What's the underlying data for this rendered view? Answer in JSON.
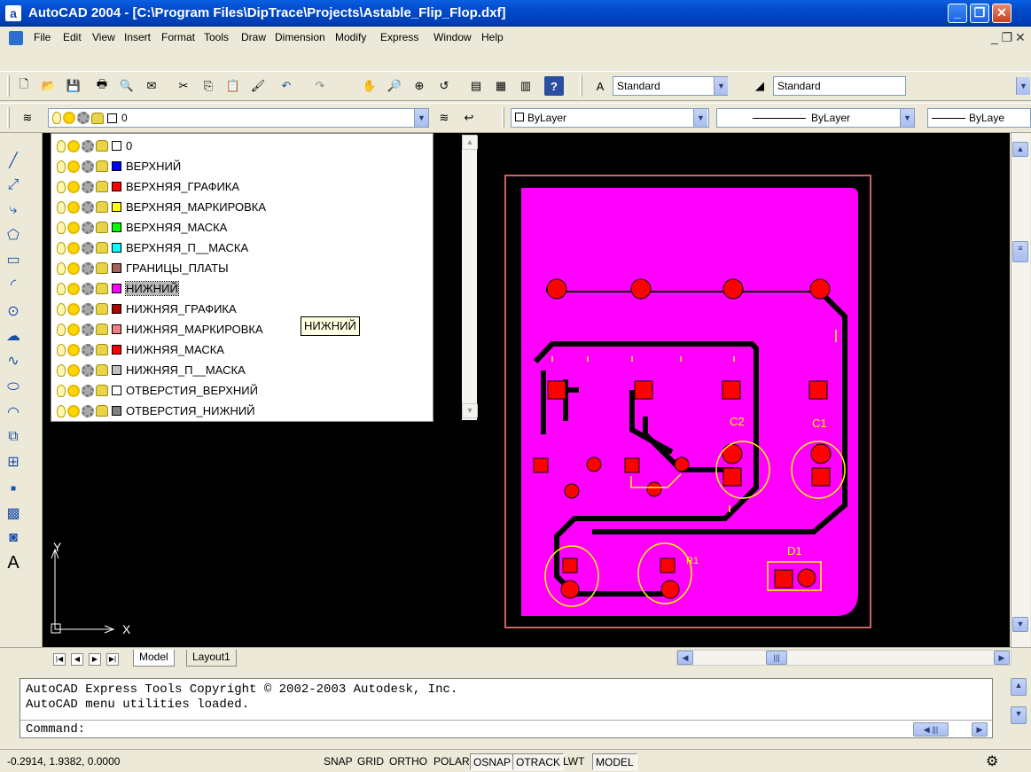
{
  "window": {
    "title": "AutoCAD 2004 - [C:\\Program Files\\DipTrace\\Projects\\Astable_Flip_Flop.dxf]",
    "app_letter": "a"
  },
  "menu": {
    "items": [
      "File",
      "Edit",
      "View",
      "Insert",
      "Format",
      "Tools",
      "Draw",
      "Dimension",
      "Modify",
      "Express",
      "Window",
      "Help"
    ]
  },
  "styles_toolbar": {
    "text_style": "Standard",
    "dim_style": "Standard"
  },
  "layers_toolbar": {
    "current_layer": "0",
    "color": "ByLayer",
    "linetype": "ByLayer",
    "lineweight": "ByLaye"
  },
  "layer_list": [
    {
      "name": "0",
      "color": "#ffffff"
    },
    {
      "name": "ВЕРХНИЙ",
      "color": "#0000ff"
    },
    {
      "name": "ВЕРХНЯЯ_ГРАФИКА",
      "color": "#ff0000"
    },
    {
      "name": "ВЕРХНЯЯ_МАРКИРОВКА",
      "color": "#ffff00"
    },
    {
      "name": "ВЕРХНЯЯ_МАСКА",
      "color": "#00ff00"
    },
    {
      "name": "ВЕРХНЯЯ_П__МАСКА",
      "color": "#00ffff"
    },
    {
      "name": "ГРАНИЦЫ_ПЛАТЫ",
      "color": "#a0645a"
    },
    {
      "name": "НИЖНИЙ",
      "color": "#ff00ff",
      "selected": true
    },
    {
      "name": "НИЖНЯЯ_ГРАФИКА",
      "color": "#b00000"
    },
    {
      "name": "НИЖНЯЯ_МАРКИРОВКА",
      "color": "#f08080"
    },
    {
      "name": "НИЖНЯЯ_МАСКА",
      "color": "#ff0000"
    },
    {
      "name": "НИЖНЯЯ_П__МАСКА",
      "color": "#c0c0c0"
    },
    {
      "name": "ОТВЕРСТИЯ_ВЕРХНИЙ",
      "color": "#ffffff"
    },
    {
      "name": "ОТВЕРСТИЯ_НИЖНИЙ",
      "color": "#808080"
    }
  ],
  "tooltip": "НИЖНИЙ",
  "ucs": {
    "x_label": "X",
    "y_label": "Y"
  },
  "pcb": {
    "labels": [
      "C2",
      "C1",
      "D1",
      "R1"
    ]
  },
  "tabs": [
    "Model",
    "Layout1"
  ],
  "command": {
    "history": [
      "AutoCAD Express Tools Copyright © 2002-2003 Autodesk, Inc.",
      "AutoCAD menu utilities loaded."
    ],
    "prompt": "Command:"
  },
  "status": {
    "coords": "-0.2914, 1.9382, 0.0000",
    "toggles": [
      {
        "label": "SNAP",
        "on": false
      },
      {
        "label": "GRID",
        "on": false
      },
      {
        "label": "ORTHO",
        "on": false
      },
      {
        "label": "POLAR",
        "on": false
      },
      {
        "label": "OSNAP",
        "on": true
      },
      {
        "label": "OTRACK",
        "on": true
      },
      {
        "label": "LWT",
        "on": false
      },
      {
        "label": "MODEL",
        "on": true
      }
    ]
  },
  "colors": {
    "board": "#ff00ff",
    "pads": "#ff0000",
    "silk": "#ffff00",
    "outline": "#c86464",
    "canvas": "#000000"
  }
}
